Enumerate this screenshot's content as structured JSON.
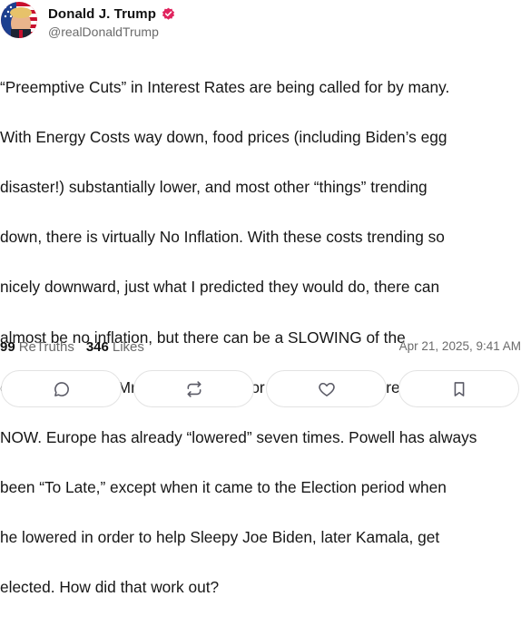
{
  "post": {
    "author": {
      "display_name": "Donald J. Trump",
      "handle": "@realDonaldTrump",
      "verified": true,
      "verified_color": "#e0245e"
    },
    "text": "“Preemptive Cuts” in Interest Rates are being called for by many. With Energy Costs way down, food prices (including Biden’s egg disaster!) substantially lower, and most other “things” trending down, there is virtually No Inflation. With these costs trending so nicely downward, just what I predicted they would do, there can almost be no inflation, but there can be a SLOWING of the economy unless Mr. Too Late, a major loser, lowers interest rates, NOW. Europe has already “lowered” seven times. Powell has always been “To Late,” except when it came to the Election period when he lowered in order to help Sleepy Joe Biden, later Kamala, get elected. How did that work out?",
    "lines": [
      "“Preemptive Cuts” in Interest Rates are being called for by many.",
      "With Energy Costs way down, food prices (including Biden’s egg",
      "disaster!) substantially lower, and most other “things” trending",
      "down, there is virtually No Inflation. With these costs trending so",
      "nicely downward, just what I predicted they would do, there can",
      "almost be no inflation, but there can be a SLOWING of the",
      "economy unless Mr. Too Late, a major loser, lowers interest rates,",
      "NOW. Europe has already “lowered” seven times. Powell has always",
      "been “To Late,” except when it came to the Election period when",
      "he lowered in order to help Sleepy Joe Biden, later Kamala, get",
      "elected. How did that work out?"
    ],
    "stats": {
      "retruths_count": "99",
      "retruths_label": "ReTruths",
      "likes_count": "346",
      "likes_label": "Likes"
    },
    "timestamp": "Apr 21, 2025, 9:41 AM",
    "actions": [
      {
        "name": "reply",
        "icon": "reply-icon"
      },
      {
        "name": "retruth",
        "icon": "retruth-icon"
      },
      {
        "name": "like",
        "icon": "heart-icon"
      },
      {
        "name": "bookmark",
        "icon": "bookmark-icon"
      }
    ]
  },
  "colors": {
    "text": "#161616",
    "muted": "#6b6b6b",
    "border": "#e3e3e3",
    "icon": "#5a5a66"
  }
}
